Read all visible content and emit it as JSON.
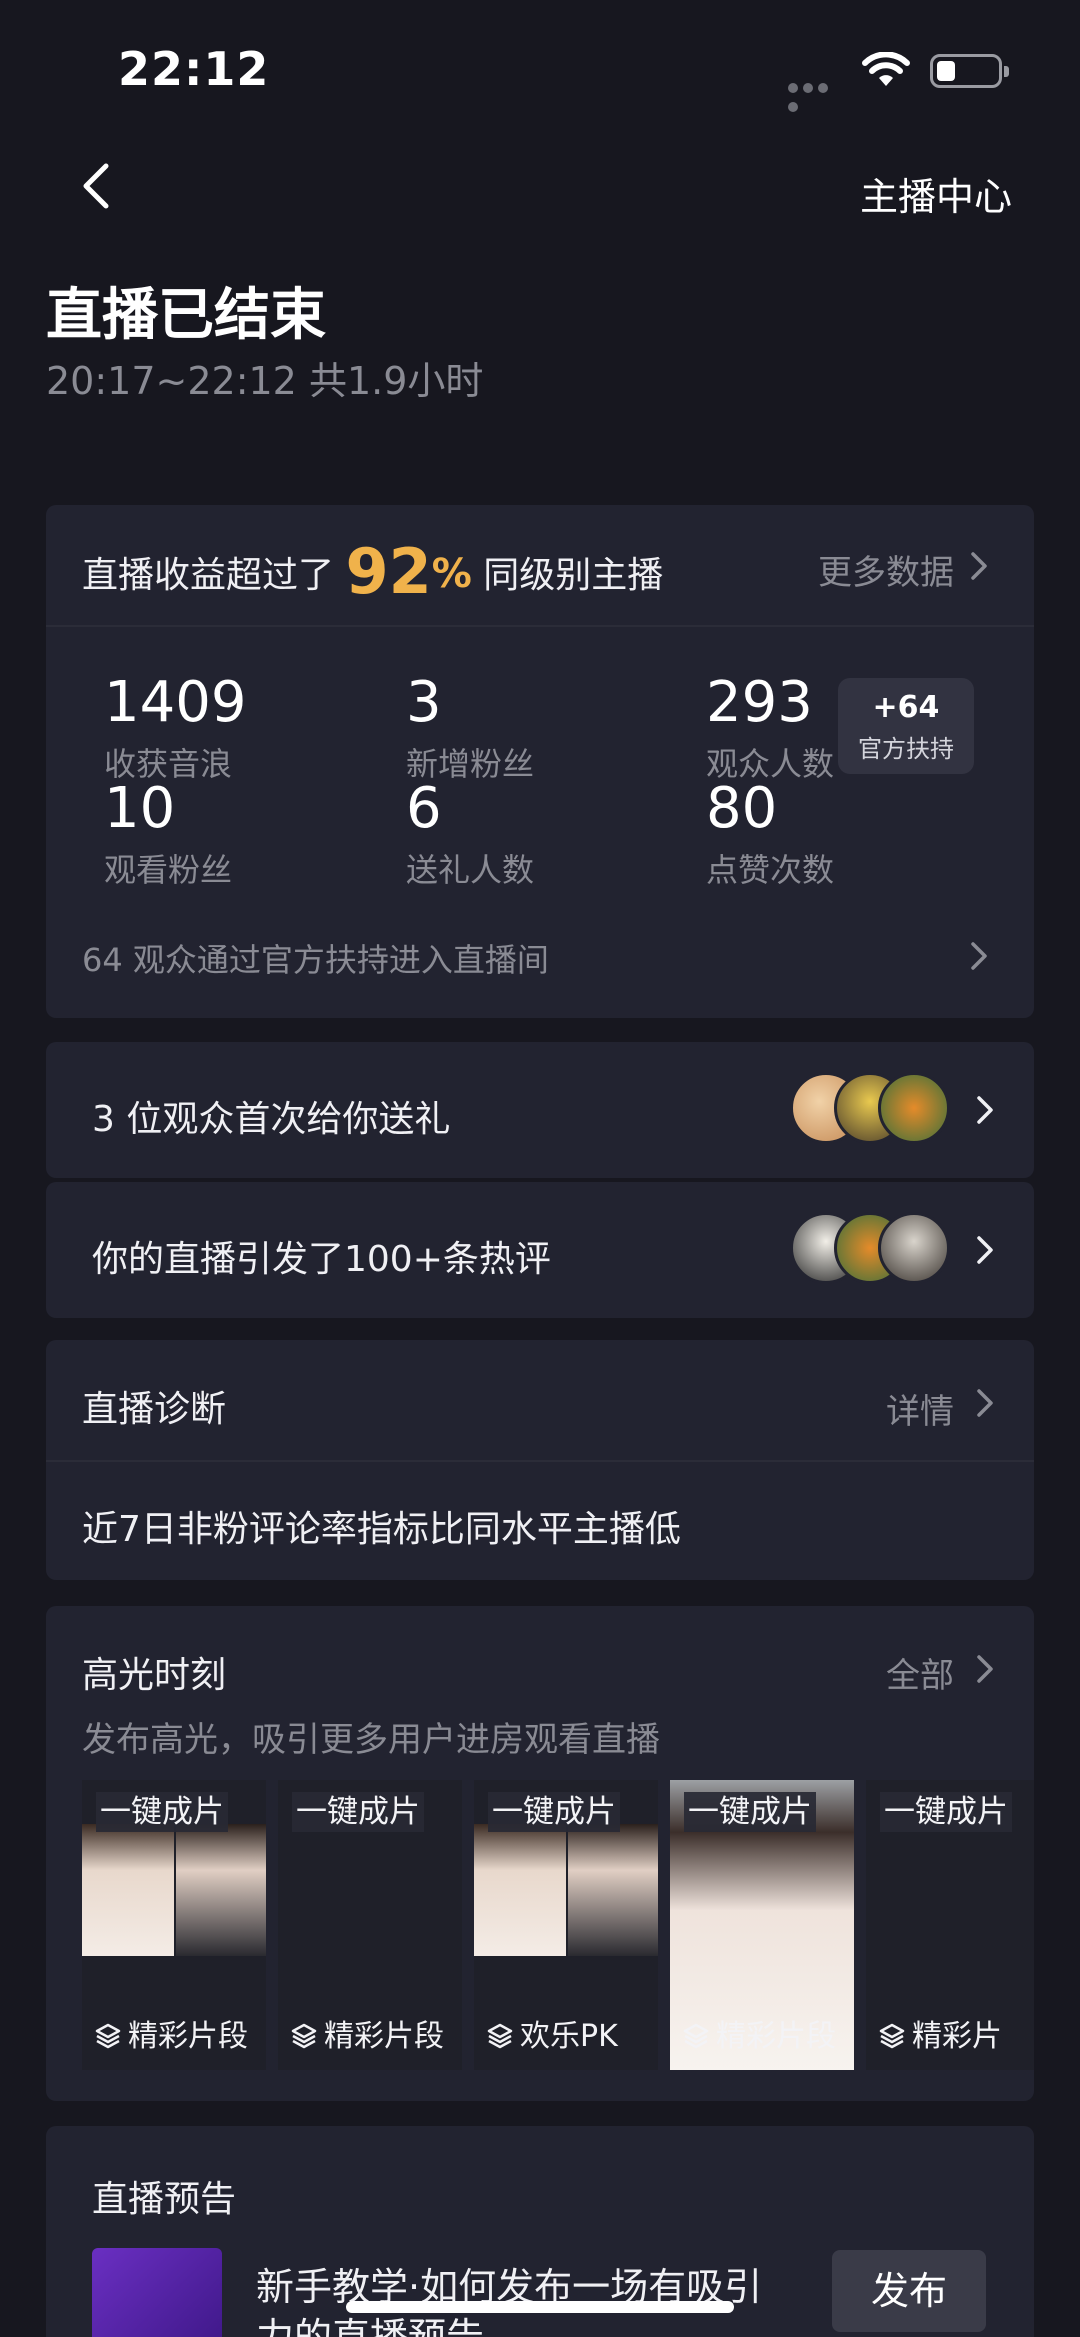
{
  "status_bar": {
    "time": "22:12",
    "battery_level": 0.2
  },
  "header": {
    "anchor_center": "主播中心",
    "title": "直播已结束",
    "subtitle": "20:17~22:12  共1.9小时"
  },
  "earnings": {
    "prefix": "直播收益超过了",
    "percent": "92",
    "percent_sign": "%",
    "suffix": "同级别主播",
    "more": "更多数据",
    "stats": [
      {
        "value": "1409",
        "label": "收获音浪"
      },
      {
        "value": "3",
        "label": "新增粉丝"
      },
      {
        "value": "293",
        "label": "观众人数"
      },
      {
        "value": "10",
        "label": "观看粉丝"
      },
      {
        "value": "6",
        "label": "送礼人数"
      },
      {
        "value": "80",
        "label": "点赞次数"
      }
    ],
    "boost": {
      "value": "+64",
      "label": "官方扶持"
    },
    "boost_note": "64 观众通过官方扶持进入直播间"
  },
  "rows": [
    {
      "label": "3 位观众首次给你送礼"
    },
    {
      "label": "你的直播引发了100+条热评"
    }
  ],
  "diagnosis": {
    "title": "直播诊断",
    "detail": "详情",
    "text": "近7日非粉评论率指标比同水平主播低"
  },
  "highlights": {
    "title": "高光时刻",
    "all": "全部",
    "desc": "发布高光，吸引更多用户进房观看直播",
    "clips": [
      {
        "top": "一键成片",
        "bottom": "精彩片段"
      },
      {
        "top": "一键成片",
        "bottom": "精彩片段"
      },
      {
        "top": "一键成片",
        "bottom": "欢乐PK"
      },
      {
        "top": "一键成片",
        "bottom": "精彩片段"
      },
      {
        "top": "一键成片",
        "bottom": "精彩片"
      }
    ]
  },
  "preview": {
    "title": "直播预告",
    "text": "新手教学·如何发布一场有吸引力的直播预告",
    "publish": "发布"
  },
  "colors": {
    "background": "#17171f",
    "card": "#222330",
    "accent": "#f0b24b",
    "muted": "#8a8b94"
  },
  "icons": [
    "back-arrow-icon",
    "wifi-icon",
    "battery-icon",
    "chevron-right-icon",
    "layers-icon"
  ]
}
